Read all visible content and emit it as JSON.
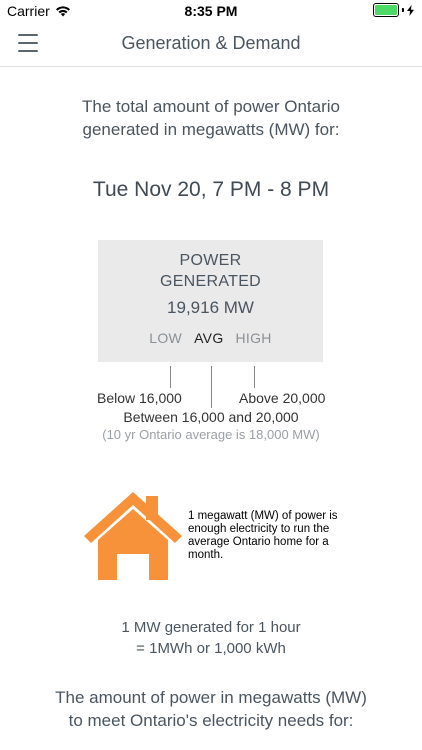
{
  "status": {
    "carrier": "Carrier",
    "time": "8:35 PM",
    "wifi_icon": "wifi-icon",
    "battery_color": "#4cd964"
  },
  "nav": {
    "title": "Generation & Demand",
    "menu_icon": "hamburger-menu-icon"
  },
  "intro": {
    "line1": "The total amount of power Ontario",
    "line2": "generated in megawatts (MW) for:"
  },
  "date": "Tue Nov 20, 7 PM - 8 PM",
  "power": {
    "label_line1": "POWER",
    "label_line2": "GENERATED",
    "value": "19,916 MW",
    "levels": [
      "LOW",
      "AVG",
      "HIGH"
    ],
    "active_level": "AVG"
  },
  "ranges": {
    "low": "Below 16,000",
    "high": "Above 20,000",
    "avg": "Between 16,000 and 20,000",
    "note": "(10 yr Ontario average is 18,000 MW)"
  },
  "house": {
    "color": "#f7923a",
    "caption": "1 megawatt (MW) of power is enough electricity to run the average Ontario home for a month."
  },
  "mw_info": {
    "line1": "1 MW generated for 1 hour",
    "line2": "= 1MWh or 1,000 kWh"
  },
  "demand_intro": {
    "line1": "The amount of power in megawatts (MW)",
    "line2": "to meet Ontario's electricity needs for:"
  }
}
